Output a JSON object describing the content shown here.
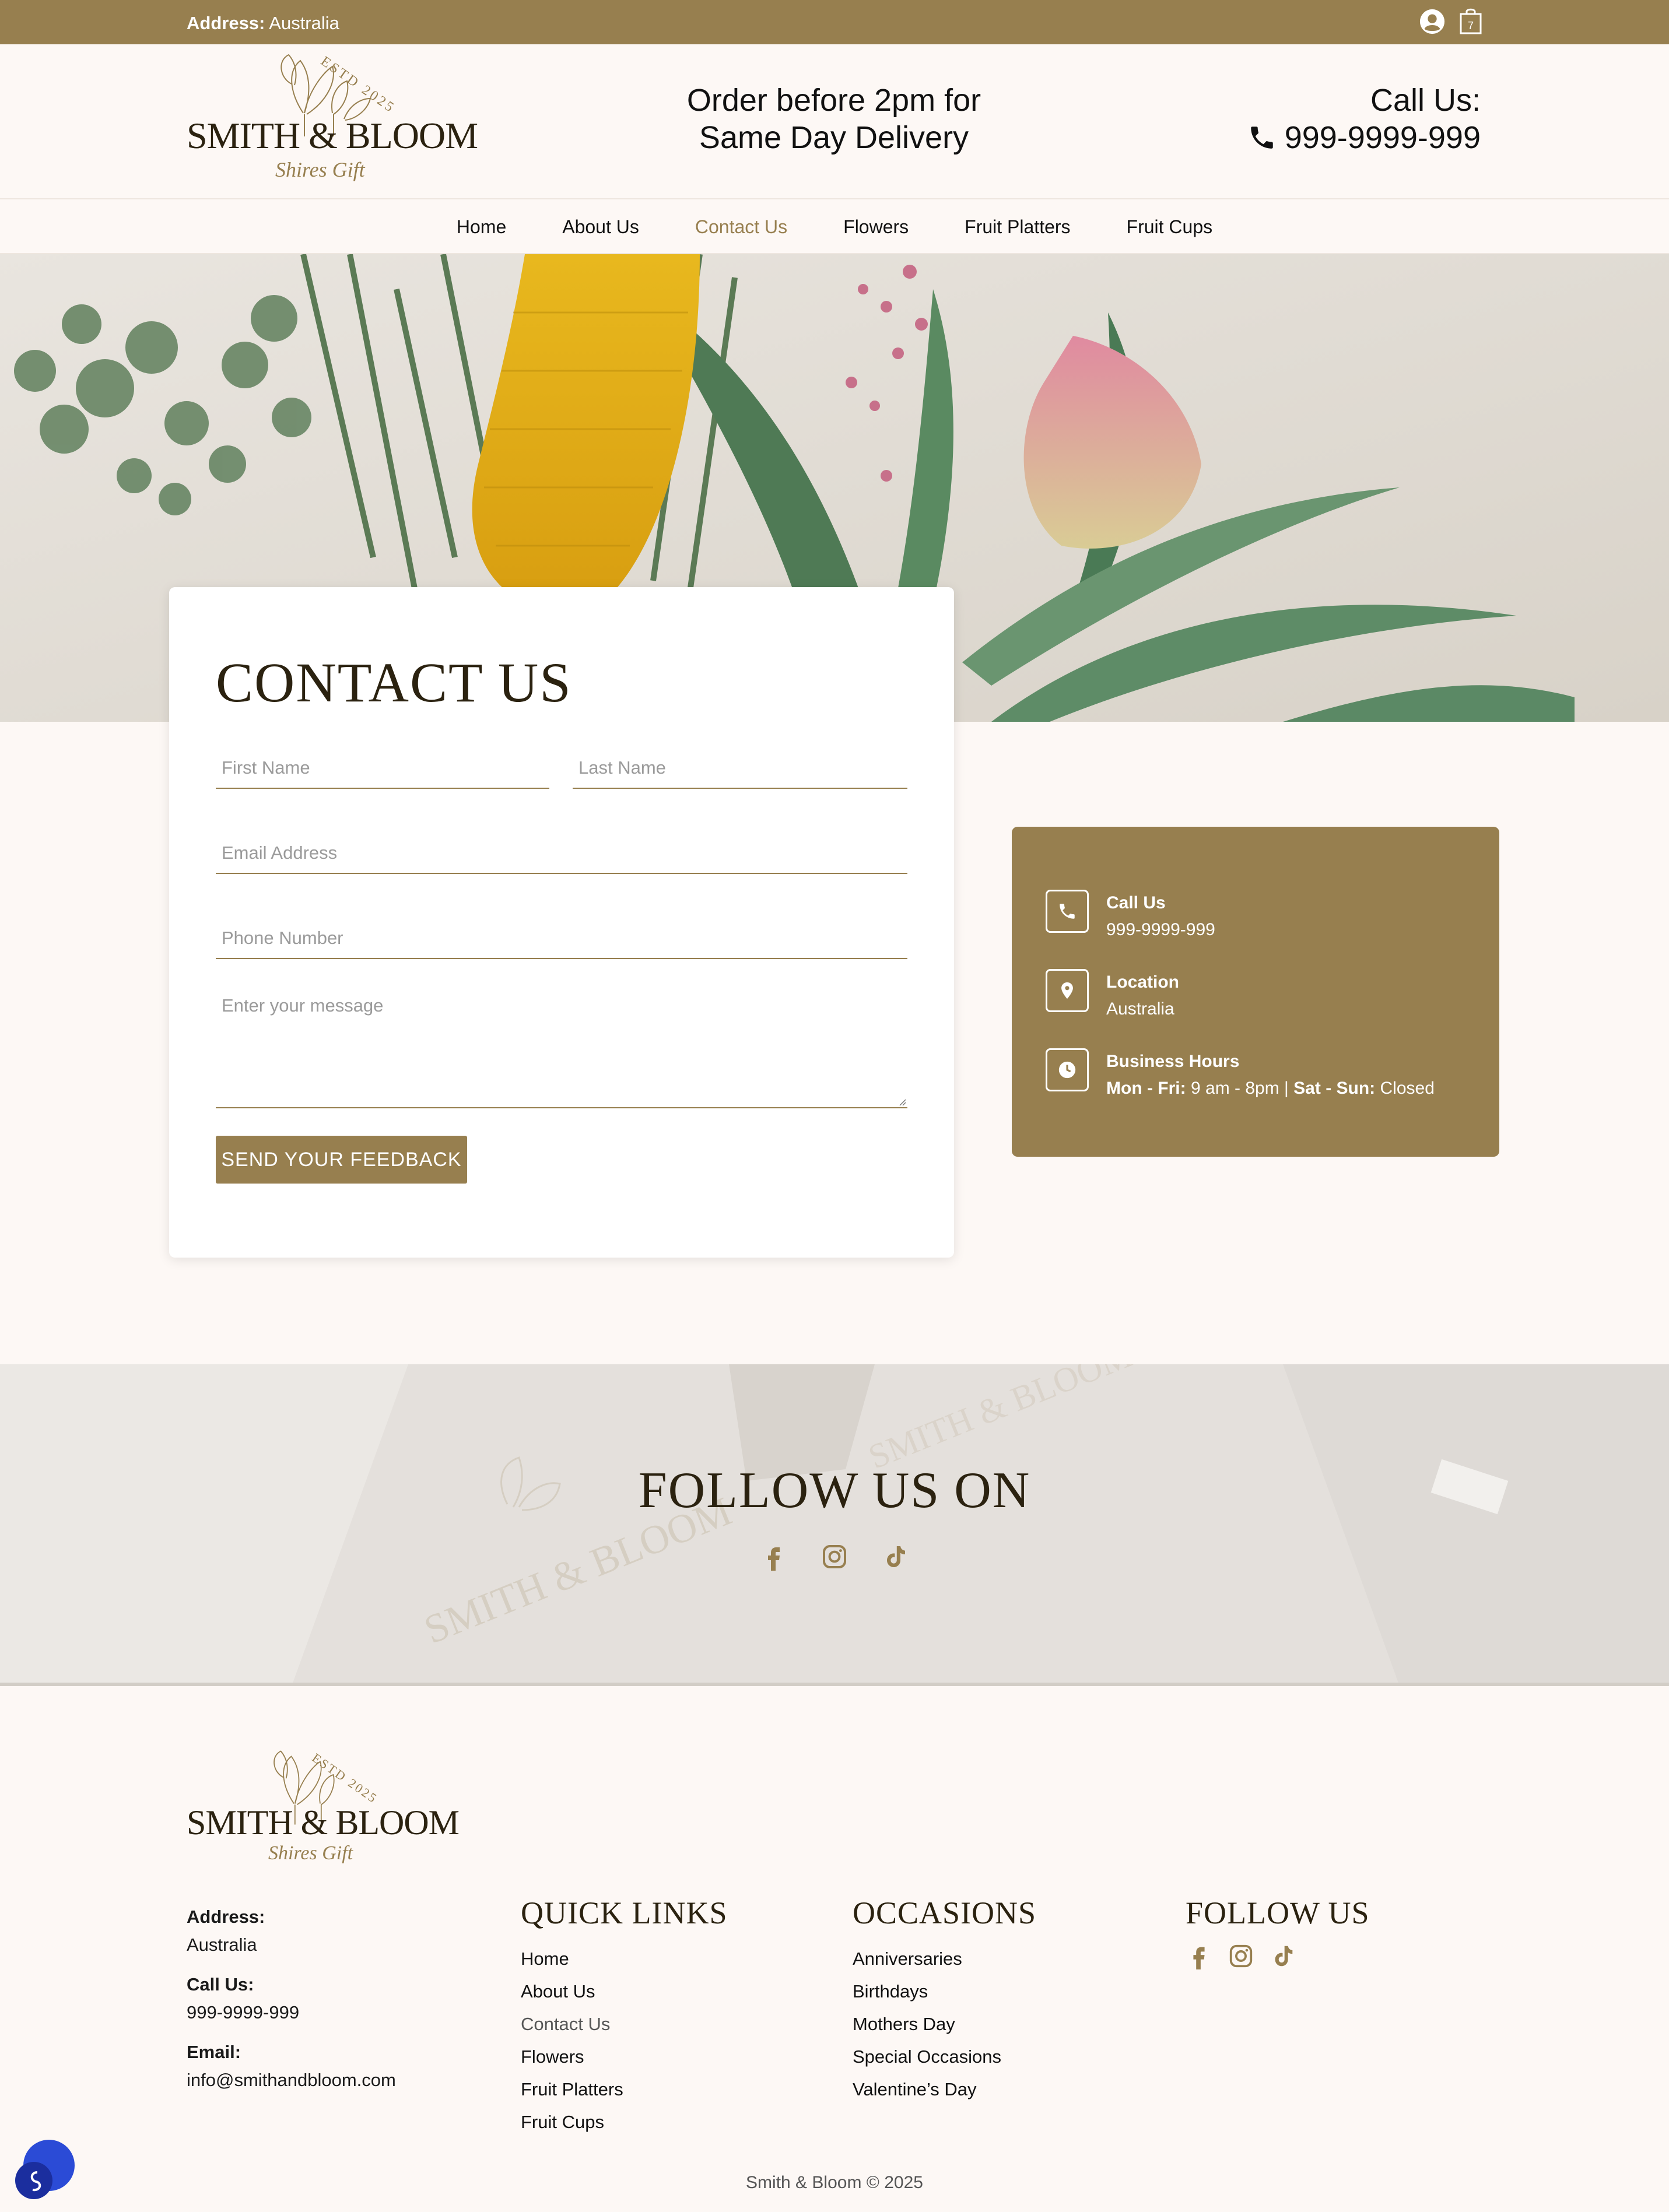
{
  "topbar": {
    "address_label": "Address:",
    "address_value": "Australia",
    "cart_count": "7"
  },
  "brand": {
    "name": "SMITH & BLOOM",
    "estd": "ESTD 2025",
    "tagline": "Shires Gift"
  },
  "header": {
    "delivery_line1": "Order before 2pm for",
    "delivery_line2": "Same Day Delivery",
    "call_label": "Call Us:",
    "call_number": "999-9999-999"
  },
  "nav": {
    "items": [
      "Home",
      "About Us",
      "Contact Us",
      "Flowers",
      "Fruit Platters",
      "Fruit Cups"
    ],
    "active": "Contact Us"
  },
  "contact_form": {
    "title": "CONTACT US",
    "first_name_placeholder": "First Name",
    "last_name_placeholder": "Last Name",
    "email_placeholder": "Email Address",
    "phone_placeholder": "Phone Number",
    "message_placeholder": "Enter your message",
    "submit_label": "SEND YOUR FEEDBACK"
  },
  "info": {
    "call_title": "Call Us",
    "call_value": "999-9999-999",
    "location_title": "Location",
    "location_value": "Australia",
    "hours_title": "Business Hours",
    "hours_weekday_label": "Mon - Fri:",
    "hours_weekday_value": "9 am - 8pm |",
    "hours_weekend_label": "Sat - Sun:",
    "hours_weekend_value": "Closed"
  },
  "follow": {
    "title": "FOLLOW US ON"
  },
  "footer": {
    "address_label": "Address:",
    "address_value": "Australia",
    "call_label": "Call Us:",
    "call_value": "999-9999-999",
    "email_label": "Email:",
    "email_value": "info@smithandbloom.com",
    "quick_links_title": "QUICK LINKS",
    "quick_links": [
      "Home",
      "About Us",
      "Contact Us",
      "Flowers",
      "Fruit Platters",
      "Fruit Cups"
    ],
    "occasions_title": "OCCASIONS",
    "occasions": [
      "Anniversaries",
      "Birthdays",
      "Mothers Day",
      "Special Occasions",
      "Valentine’s Day"
    ],
    "follow_title": "FOLLOW US",
    "copyright": "Smith & Bloom © 2025"
  },
  "colors": {
    "accent": "#977f4f",
    "dark_text": "#2b2210",
    "background": "#fdf8f5"
  },
  "icons": [
    "user-icon",
    "cart-icon",
    "phone-icon",
    "location-pin-icon",
    "clock-icon",
    "facebook-icon",
    "instagram-icon",
    "tiktok-icon",
    "chat-icon"
  ]
}
